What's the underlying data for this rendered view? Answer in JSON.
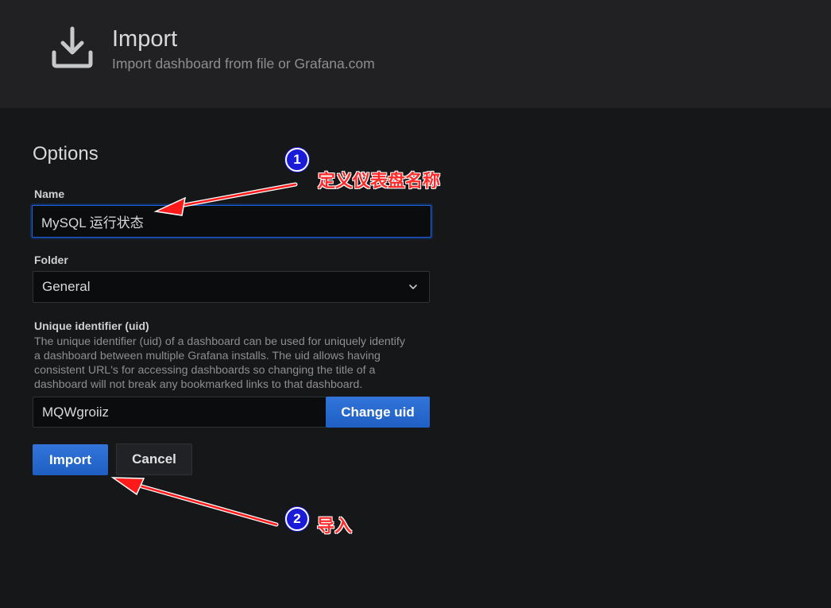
{
  "header": {
    "icon": "download-icon",
    "title": "Import",
    "subtitle": "Import dashboard from file or Grafana.com"
  },
  "options": {
    "section_title": "Options",
    "name": {
      "label": "Name",
      "value": "MySQL 运行状态"
    },
    "folder": {
      "label": "Folder",
      "value": "General",
      "icon": "chevron-down-icon"
    },
    "uid": {
      "label": "Unique identifier (uid)",
      "description_lines": [
        "The unique identifier (uid) of a dashboard can be used for uniquely identify",
        "a dashboard between multiple Grafana installs. The uid allows having",
        "consistent URL's for accessing dashboards so changing the title of a",
        "dashboard will not break any bookmarked links to that dashboard."
      ],
      "value": "MQWgroiiz",
      "change_button": "Change uid"
    },
    "import_button": "Import",
    "cancel_button": "Cancel"
  },
  "annotations": [
    {
      "number": "1",
      "text": "定义仪表盘名称",
      "color": "#ff2a2a"
    },
    {
      "number": "2",
      "text": "导入",
      "color": "#ff2a2a"
    }
  ]
}
